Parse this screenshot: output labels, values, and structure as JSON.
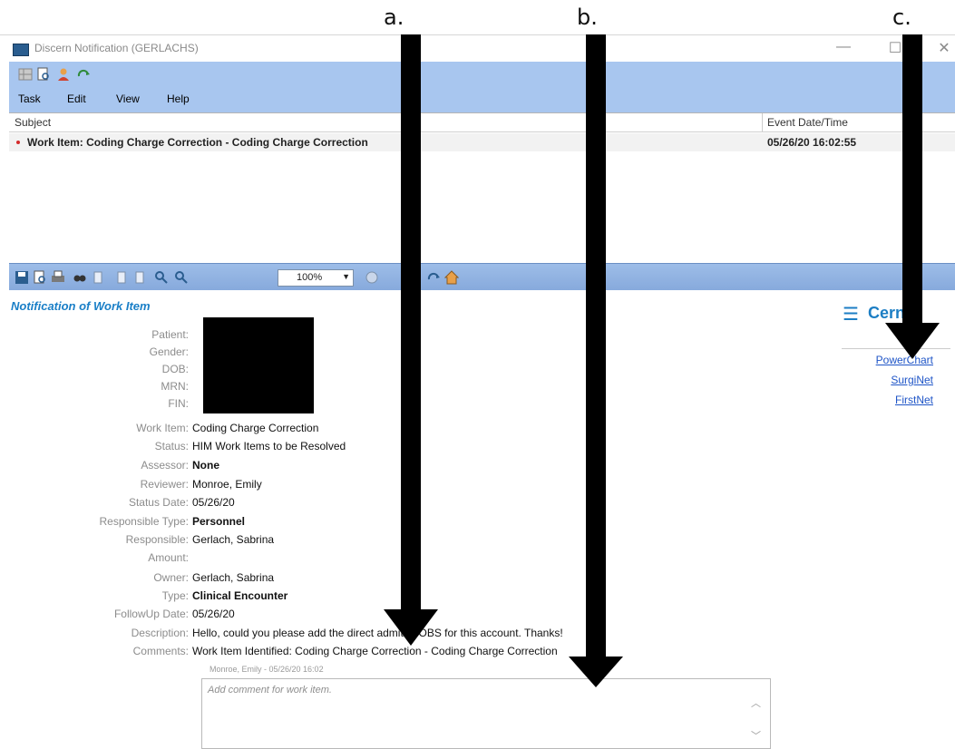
{
  "annotations": {
    "a": "a.",
    "b": "b.",
    "c": "c."
  },
  "window": {
    "title": "Discern Notification (GERLACHS)",
    "minimize": "—",
    "maximize": "☐",
    "close": "✕"
  },
  "menu": {
    "task": "Task",
    "edit": "Edit",
    "view": "View",
    "help": "Help"
  },
  "list": {
    "headers": {
      "subject": "Subject",
      "event_datetime": "Event Date/Time"
    },
    "rows": [
      {
        "subject": "Work Item: Coding Charge Correction - Coding Charge Correction",
        "event_datetime": "05/26/20 16:02:55"
      }
    ]
  },
  "toolbar2": {
    "zoom": "100%"
  },
  "content": {
    "title": "Notification of Work Item",
    "logo": "Cerner",
    "links": {
      "powerchart": "PowerChart",
      "surginet": "SurgiNet",
      "firstnet": "FirstNet"
    },
    "fields": [
      {
        "label": "Patient:",
        "value": ""
      },
      {
        "label": "Gender:",
        "value": ""
      },
      {
        "label": "DOB:",
        "value": ""
      },
      {
        "label": "MRN:",
        "value": ""
      },
      {
        "label": "FIN:",
        "value": ""
      },
      {
        "label": "Work Item:",
        "value": "Coding Charge Correction"
      },
      {
        "label": "Status:",
        "value": "HIM Work Items to be Resolved"
      },
      {
        "label": "Assessor:",
        "value": "None"
      },
      {
        "label": "Reviewer:",
        "value": "Monroe, Emily"
      },
      {
        "label": "Status Date:",
        "value": "05/26/20"
      },
      {
        "label": "Responsible Type:",
        "value": "Personnel"
      },
      {
        "label": "Responsible:",
        "value": "Gerlach, Sabrina"
      },
      {
        "label": "Amount:",
        "value": ""
      },
      {
        "label": "Owner:",
        "value": "Gerlach, Sabrina"
      },
      {
        "label": "Type:",
        "value": "Clinical Encounter"
      },
      {
        "label": "FollowUp Date:",
        "value": "05/26/20"
      },
      {
        "label": "Description:",
        "value": "Hello, could you please add the direct admit to OBS for this account. Thanks!"
      },
      {
        "label": "Comments:",
        "value": "Work Item Identified: Coding Charge Correction - Coding Charge Correction"
      }
    ],
    "comment_meta": "Monroe, Emily - 05/26/20 16:02",
    "comment_placeholder": "Add comment for work item."
  }
}
